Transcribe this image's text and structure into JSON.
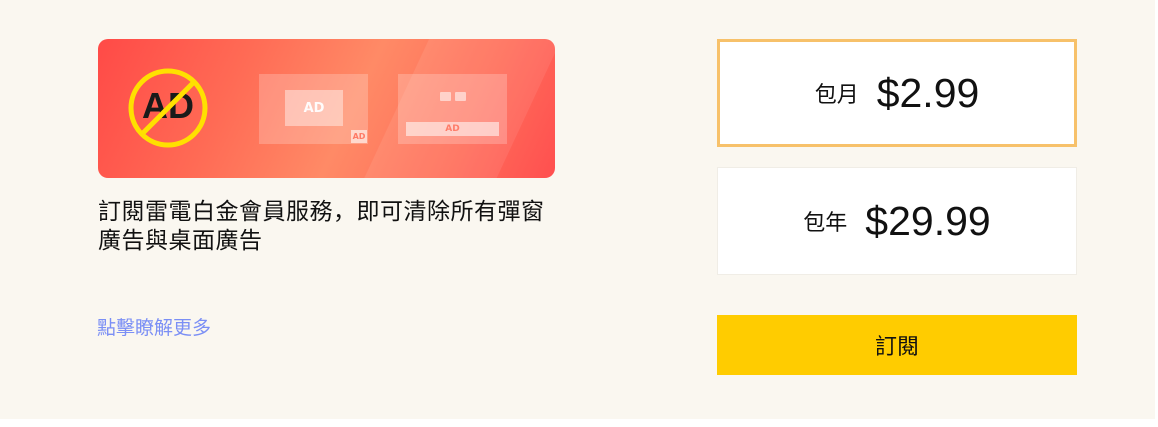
{
  "banner": {
    "no_ad_icon": "no-ad-icon",
    "mock_popup_ad": "AD",
    "mock_popup_corner": "AD",
    "mock_desktop_ad": "AD"
  },
  "description": "訂閱雷電白金會員服務，即可清除所有彈窗廣告與桌面廣告",
  "learn_more": "點擊瞭解更多",
  "plans": [
    {
      "label": "包月",
      "price": "$2.99",
      "selected": true
    },
    {
      "label": "包年",
      "price": "$29.99",
      "selected": false
    }
  ],
  "subscribe_label": "訂閱",
  "colors": {
    "accent": "#ffcc00",
    "selected_border": "#f7c16a",
    "link": "#7b8ff5",
    "banner_red": "#ff4a47",
    "background": "#faf7f0"
  }
}
